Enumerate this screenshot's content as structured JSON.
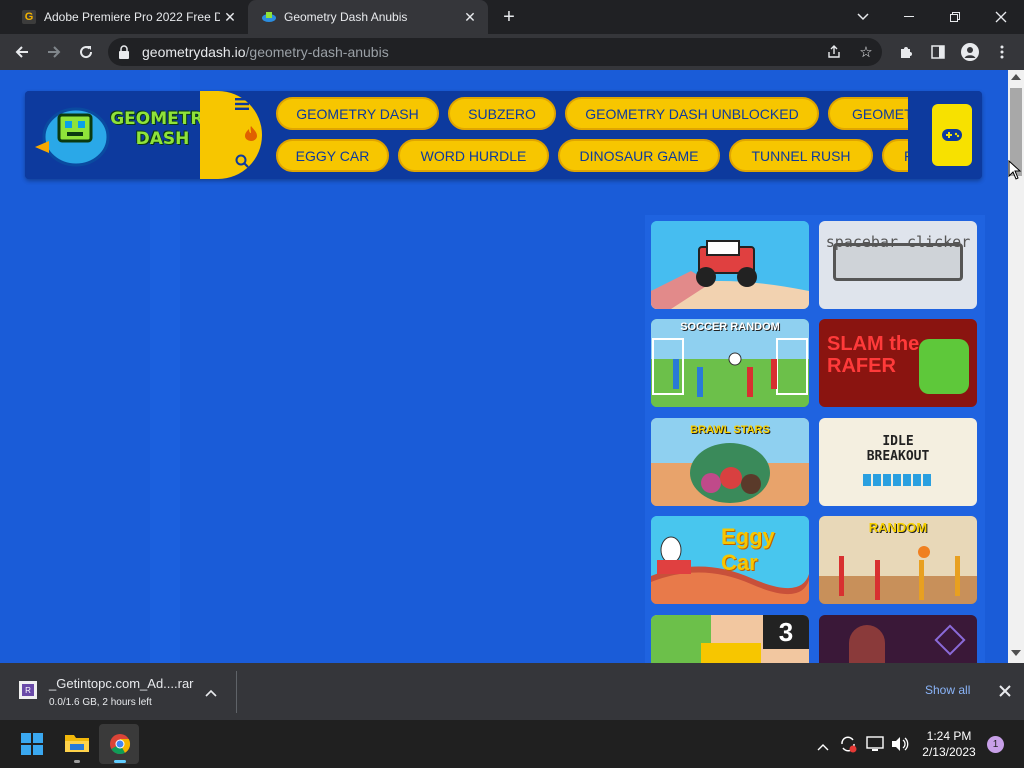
{
  "tabs": [
    {
      "title": "Adobe Premiere Pro 2022 Free D",
      "favicon": "G",
      "active": false
    },
    {
      "title": "Geometry Dash Anubis",
      "favicon": "gd-icon",
      "active": true
    }
  ],
  "new_tab_label": "+",
  "address": {
    "domain": "geometrydash.io",
    "path": "/geometry-dash-anubis"
  },
  "site": {
    "logo_line1": "GEOMETRY",
    "logo_line2": "DASH",
    "nav_row1": [
      "GEOMETRY DASH",
      "SUBZERO",
      "GEOMETRY DASH UNBLOCKED",
      "GEOMET"
    ],
    "nav_row2": [
      "EGGY CAR",
      "WORD HURDLE",
      "DINOSAUR GAME",
      "TUNNEL RUSH",
      "F"
    ]
  },
  "game_cards": [
    {
      "name": "monster-truck-card",
      "text": "",
      "bg": "#3fb6e8"
    },
    {
      "name": "spacebar-clicker-card",
      "text": "spacebar clicker",
      "bg": "#dfe4ec"
    },
    {
      "name": "soccer-random-card",
      "text": "SOCCER RANDOM",
      "bg": "#6cc04a"
    },
    {
      "name": "slam-the-rafer-card",
      "text": "SLAM the RAFER",
      "bg": "#8a1410"
    },
    {
      "name": "brawl-stars-card",
      "text": "BRAWL STARS",
      "bg": "#e8a36b"
    },
    {
      "name": "idle-breakout-card",
      "text": "IDLE BREAKOUT",
      "bg": "#f4efe0"
    },
    {
      "name": "eggy-car-card",
      "text": "Eggy Car",
      "bg": "#3fc0ea"
    },
    {
      "name": "basket-random-card",
      "text": "RANDOM",
      "bg": "#7a5a3a"
    },
    {
      "name": "bus-game-card",
      "text": "3",
      "bg": "#f2c7a0"
    },
    {
      "name": "dark-game-card",
      "text": "",
      "bg": "#3a1838"
    }
  ],
  "download": {
    "filename": "_Getintopc.com_Ad....rar",
    "status": "0.0/1.6 GB, 2 hours left",
    "show_all": "Show all"
  },
  "taskbar": {
    "time": "1:24 PM",
    "date": "2/13/2023",
    "notifications": "1"
  }
}
